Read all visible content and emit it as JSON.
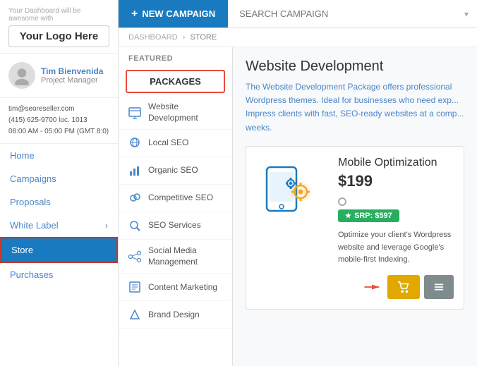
{
  "sidebar": {
    "logo_sublabel": "Your Dashboard will be awesome with",
    "logo_text": "Your Logo Here",
    "user": {
      "name": "Tim Bienvenida",
      "role": "Project Manager",
      "email": "tim@seoreseller.com",
      "phone": "(415) 625-9700 loc. 1013",
      "hours": "08:00 AM - 05:00 PM (GMT 8:0)"
    },
    "nav": [
      {
        "label": "Home",
        "active": false
      },
      {
        "label": "Campaigns",
        "active": false
      },
      {
        "label": "Proposals",
        "active": false
      },
      {
        "label": "White Label",
        "active": false,
        "has_chevron": true
      },
      {
        "label": "Store",
        "active": true
      },
      {
        "label": "Purchases",
        "active": false
      }
    ]
  },
  "topbar": {
    "new_campaign_label": "NEW CAMPAIGN",
    "search_placeholder": "SEARCH CAMPAIGN"
  },
  "breadcrumb": {
    "items": [
      "DASHBOARD",
      "STORE"
    ]
  },
  "left_panel": {
    "featured_label": "FEATURED",
    "packages_label": "PACKAGES",
    "items": [
      {
        "label": "Website Development",
        "icon": "web"
      },
      {
        "label": "Local SEO",
        "icon": "local"
      },
      {
        "label": "Organic SEO",
        "icon": "organic"
      },
      {
        "label": "Competitive SEO",
        "icon": "competitive"
      },
      {
        "label": "SEO Services",
        "icon": "services"
      },
      {
        "label": "Social Media Management",
        "icon": "social"
      },
      {
        "label": "Content Marketing",
        "icon": "content"
      },
      {
        "label": "Brand Design",
        "icon": "brand"
      }
    ]
  },
  "product": {
    "section_title": "Website Development",
    "section_desc": "The Website Development Package offers professional Wordpress themes. Ideal for businesses who need exp... Impress clients with fast, SEO-ready websites at a comp... weeks.",
    "card": {
      "name": "Mobile Optimization",
      "price": "$199",
      "srp_label": "SRP: $597",
      "description": "Optimize your client's Wordpress website and leverage Google's mobile-first Indexing."
    }
  }
}
